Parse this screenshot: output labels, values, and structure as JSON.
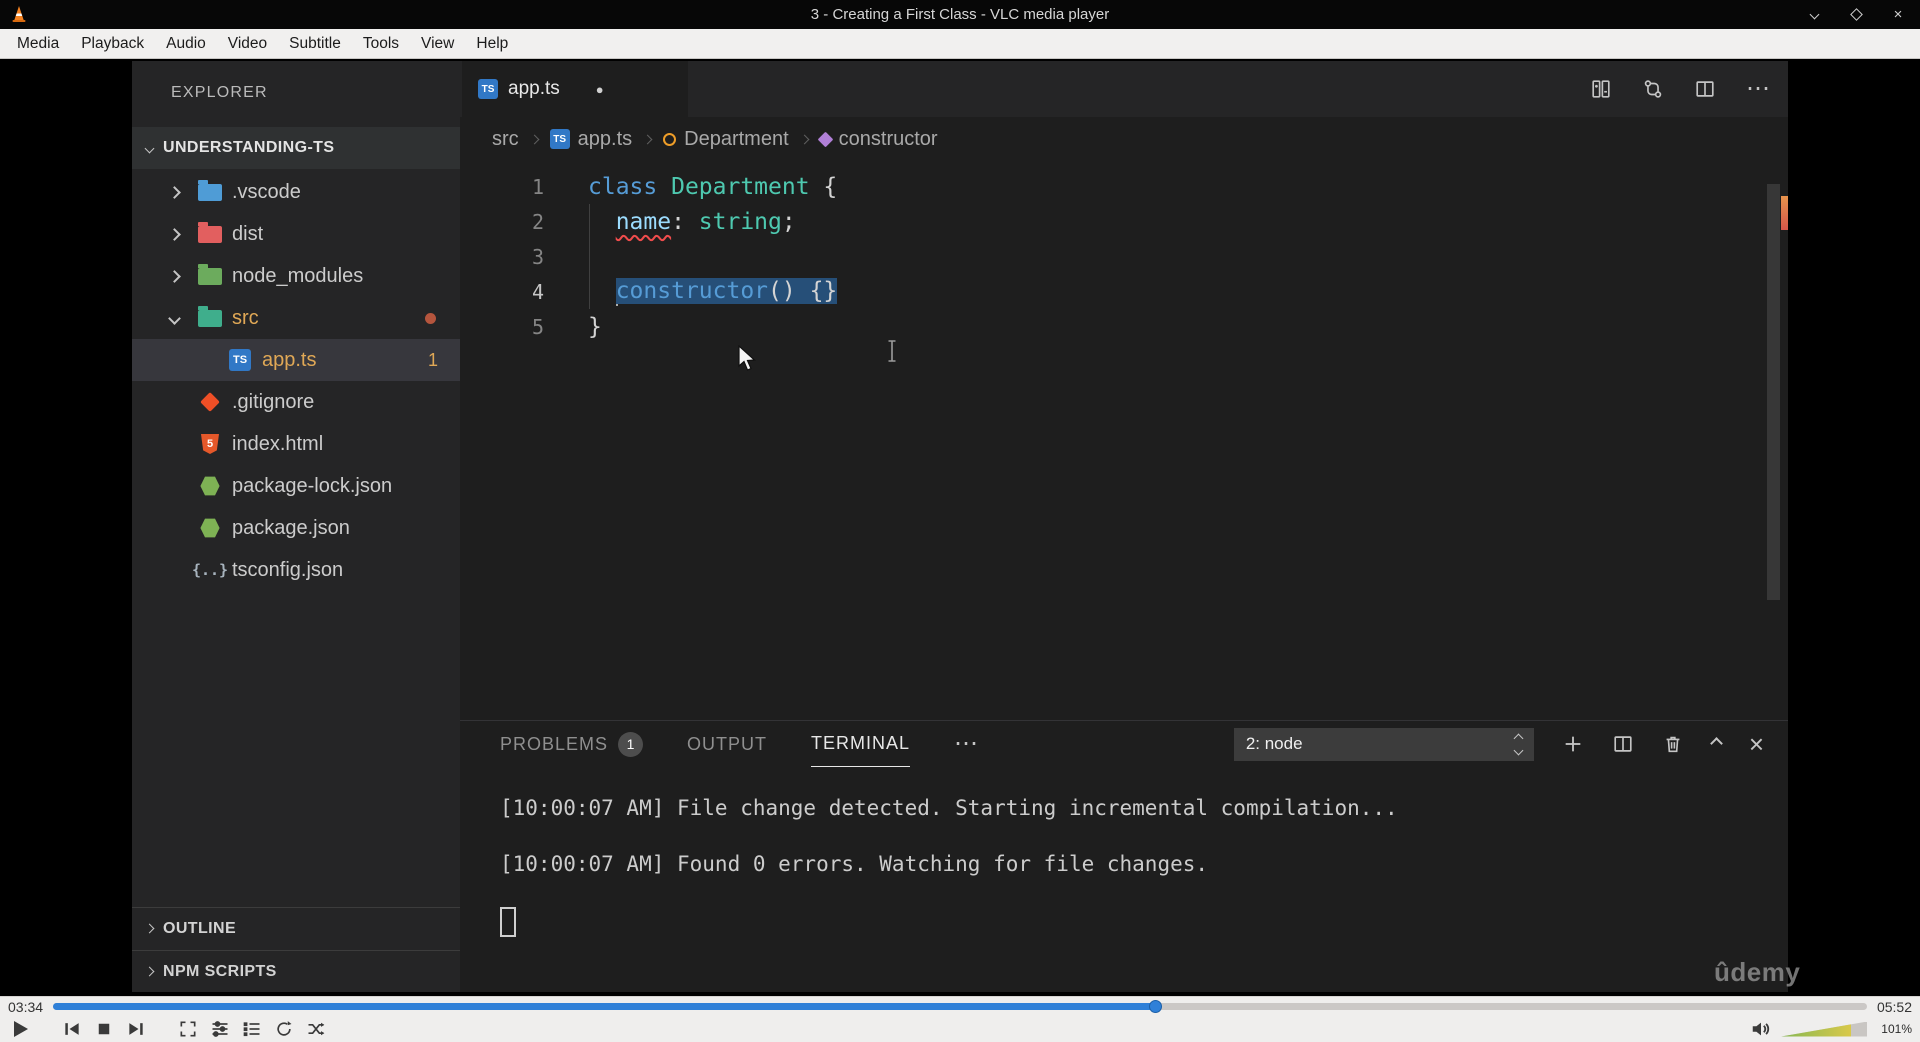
{
  "icons": {
    "close": "×",
    "more": "⋯",
    "dirty": "●",
    "ts_badge": "TS",
    "html_badge": "5",
    "tsconfig_glyph": "{..}"
  },
  "vlc": {
    "title": "3 - Creating a First Class - VLC media player",
    "menu": [
      "Media",
      "Playback",
      "Audio",
      "Video",
      "Subtitle",
      "Tools",
      "View",
      "Help"
    ],
    "elapsed": "03:34",
    "duration": "05:52",
    "progress_width": "60.8%",
    "volume_percent": "101%",
    "volume_width": "81%"
  },
  "video": {
    "watermark": "ûdemy"
  },
  "vscode": {
    "explorer": {
      "title": "EXPLORER",
      "root": "UNDERSTANDING-TS",
      "items": [
        {
          "label": ".vscode"
        },
        {
          "label": "dist"
        },
        {
          "label": "node_modules"
        },
        {
          "label": "src"
        },
        {
          "label": "app.ts",
          "badge": "1"
        },
        {
          "label": ".gitignore"
        },
        {
          "label": "index.html"
        },
        {
          "label": "package-lock.json"
        },
        {
          "label": "package.json"
        },
        {
          "label": "tsconfig.json"
        }
      ],
      "sections": [
        {
          "label": "OUTLINE"
        },
        {
          "label": "NPM SCRIPTS"
        }
      ]
    },
    "editor": {
      "tab": "app.ts",
      "breadcrumb": [
        "src",
        "app.ts",
        "Department",
        "constructor"
      ],
      "code": {
        "lines": [
          {
            "num": "1",
            "tokens": [
              {
                "text": "class "
              },
              {
                "text": "Department"
              },
              {
                "text": " {"
              }
            ]
          },
          {
            "num": "2",
            "tokens": [
              {
                "text": "  "
              },
              {
                "text": "name"
              },
              {
                "text": ": "
              },
              {
                "text": "string"
              },
              {
                "text": ";"
              }
            ]
          },
          {
            "num": "3",
            "tokens": []
          },
          {
            "num": "4",
            "tokens": [
              {
                "text": "  "
              },
              {
                "text": "constructor"
              },
              {
                "text": "() {}"
              }
            ]
          },
          {
            "num": "5",
            "tokens": [
              {
                "text": "}"
              }
            ]
          }
        ]
      }
    },
    "panel": {
      "tabs": [
        {
          "label": "PROBLEMS",
          "badge": "1"
        },
        {
          "label": "OUTPUT"
        },
        {
          "label": "TERMINAL"
        }
      ],
      "terminal_dropdown": "2: node",
      "terminal_lines": [
        "[10:00:07 AM] File change detected. Starting incremental compilation...",
        "[10:00:07 AM] Found 0 errors. Watching for file changes."
      ]
    }
  },
  "colors": {
    "selection": "#264f78",
    "keyword": "#569cd6",
    "type": "#4ec9b0",
    "variable": "#9cdcfe",
    "modified_file": "#e0a856",
    "seek_progress": "#2f80d8",
    "error_squiggle": "#f14c4c"
  }
}
